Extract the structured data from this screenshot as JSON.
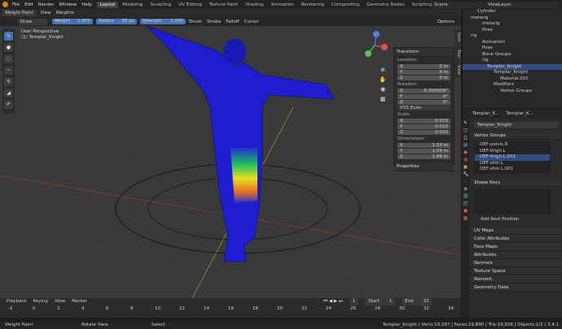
{
  "menubar": {
    "items": [
      "File",
      "Edit",
      "Render",
      "Window",
      "Help"
    ],
    "workspaces": [
      "Layout",
      "Modeling",
      "Sculpting",
      "UV Editing",
      "Texture Paint",
      "Shading",
      "Animation",
      "Rendering",
      "Compositing",
      "Geometry Nodes",
      "Scripting"
    ],
    "scene": "Scene",
    "view_layer": "ViewLayer"
  },
  "header": {
    "mode": "Weight Paint",
    "items": [
      "View",
      "Weights"
    ]
  },
  "toolhdr": {
    "brush": "Draw",
    "weight_label": "Weight",
    "weight_value": "1.000",
    "radius_label": "Radius",
    "radius_value": "50 px",
    "strength_label": "Strength",
    "strength_value": "1.000",
    "menus": [
      "Brush",
      "Stroke",
      "Falloff",
      "Cursor"
    ],
    "options": "Options"
  },
  "viewport": {
    "line1": "User Perspective",
    "line2": "(1) Templar_Knight"
  },
  "npanel": {
    "transform": "Transform",
    "location": "Location:",
    "loc": [
      {
        "a": "X",
        "v": "0 m"
      },
      {
        "a": "Y",
        "v": "0 m"
      },
      {
        "a": "Z",
        "v": "0 m"
      }
    ],
    "rotation": "Rotation:",
    "rot": [
      {
        "a": "X",
        "v": "-0.000009°"
      },
      {
        "a": "Y",
        "v": "0°"
      },
      {
        "a": "Z",
        "v": "0°"
      }
    ],
    "euler": "XYZ Euler",
    "scale": "Scale:",
    "scl": [
      {
        "a": "X",
        "v": "0.010"
      },
      {
        "a": "Y",
        "v": "0.010"
      },
      {
        "a": "Z",
        "v": "0.010"
      }
    ],
    "dimensions": "Dimensions:",
    "dim": [
      {
        "a": "X",
        "v": "1.53 m"
      },
      {
        "a": "Y",
        "v": "1.09 m"
      },
      {
        "a": "Z",
        "v": "1.89 m"
      }
    ],
    "properties": "Properties"
  },
  "sidetabs": [
    "Item",
    "Tool",
    "View"
  ],
  "outliner": {
    "rows": [
      "Cylinder",
      "metarig",
      "metarig",
      "Pose",
      "rig",
      "Animation",
      "Pose",
      "Bone Groups",
      "rig",
      "Templar_Knight",
      "Templar_Knight",
      "Material.001",
      "Modifiers",
      "Vertex Groups"
    ]
  },
  "props": {
    "breadcrumb1": "Templar_K...",
    "breadcrumb2": "Templar_K...",
    "object": "Templar_Knight",
    "vertex_groups": "Vertex Groups",
    "vgroups": [
      "DEF-pelvis.R",
      "DEF-thigh.L",
      "DEF-thigh.L.001",
      "DEF-shin.L",
      "DEF-shin.L.001"
    ],
    "shape_keys": "Shape Keys",
    "add_rest": "Add Rest Position",
    "sections": [
      "UV Maps",
      "Color Attributes",
      "Face Maps",
      "Attributes",
      "Normals",
      "Texture Space",
      "Remesh",
      "Geometry Data"
    ]
  },
  "timeline": {
    "items": [
      "Playback",
      "Keying",
      "View",
      "Marker"
    ],
    "current": "1",
    "start_label": "Start",
    "start": "1",
    "end_label": "End",
    "end": "32",
    "ticks": [
      "-2",
      "0",
      "2",
      "4",
      "6",
      "8",
      "10",
      "12",
      "14",
      "16",
      "18",
      "20",
      "22",
      "24",
      "26",
      "28",
      "30",
      "32",
      "34"
    ]
  },
  "status": {
    "left": "Weight Paint",
    "mid1": "Rotate View",
    "mid2": "Select",
    "right": "Templar_Knight | Verts:10,297 | Faces:19,890 | Tris:19,928 | Objects:1/2 | 3.4.1"
  }
}
